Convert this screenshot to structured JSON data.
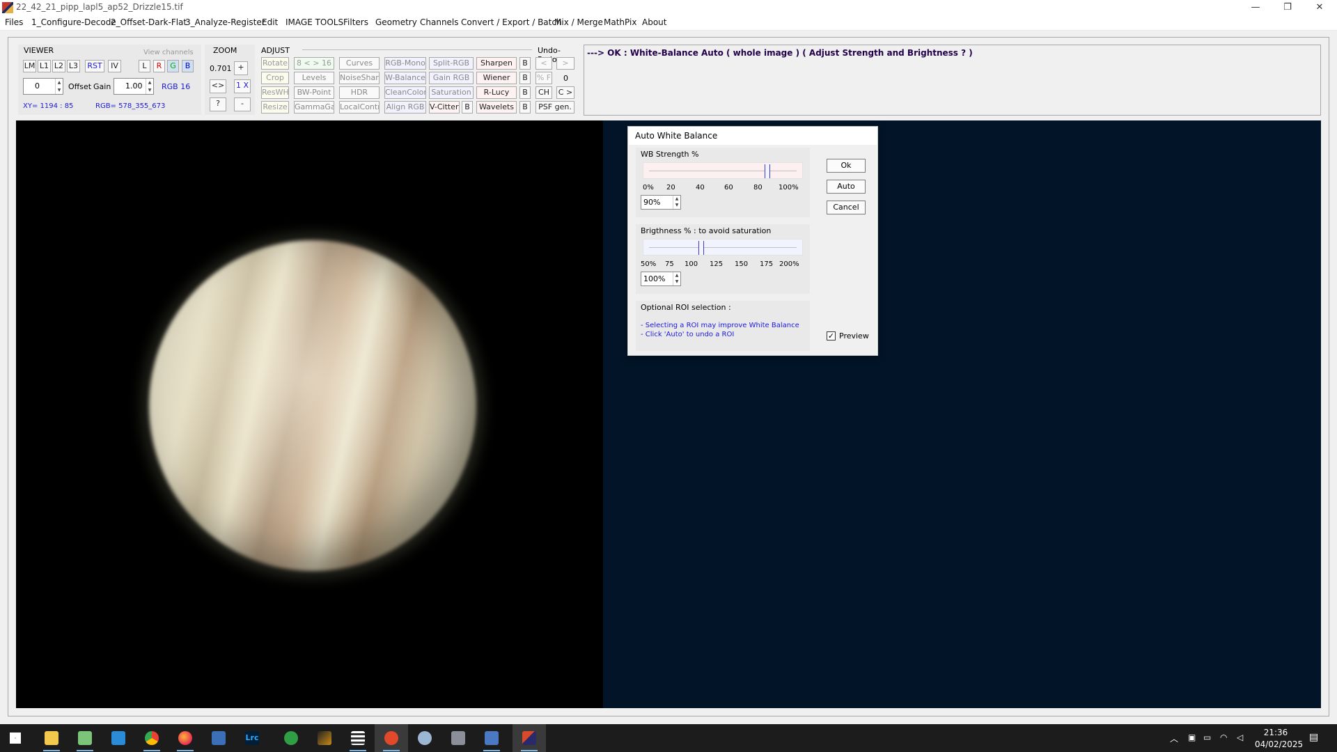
{
  "window": {
    "title": "22_42_21_pipp_lapl5_ap52_Drizzle15.tif",
    "controls": [
      "—",
      "❐",
      "✕"
    ]
  },
  "menu": [
    "Files",
    "1_Configure-Decode",
    "2_Offset-Dark-Flat",
    "3_Analyze-Register",
    "Edit",
    "IMAGE TOOLS",
    "Filters",
    "Geometry",
    "Channels",
    "Convert / Export / Batch",
    "Mix / Merge",
    "MathPix",
    "About"
  ],
  "viewer": {
    "label": "VIEWER",
    "view_channels_label": "View channels",
    "buttons": [
      "LM",
      "L1",
      "L2",
      "L3",
      "RST",
      "IV"
    ],
    "channel_buttons": [
      "L",
      "R",
      "G",
      "B"
    ],
    "offset_value": "0",
    "offset_label": "Offset",
    "gain_label": "Gain",
    "gain_value": "1.00",
    "rgb_depth": "RGB 16",
    "xy": "XY=  1194 : 85",
    "rgb": "RGB=  578_355_673"
  },
  "zoom": {
    "label": "ZOOM",
    "value": "0.701",
    "plus": "+",
    "fit": "<>",
    "one": "1 X",
    "help": "?",
    "minus": "-"
  },
  "adjust": {
    "label": "ADJUST",
    "undo_label": "Undo-Redo",
    "row1": [
      "Rotate",
      "8 < > 16",
      "Curves",
      "RGB-Mono",
      "Split-RGB",
      "Sharpen",
      "B",
      "<",
      ">"
    ],
    "row2": [
      "Crop",
      "Levels",
      "NoiseSharp",
      "W-Balance",
      "Gain RGB",
      "Wiener",
      "B",
      "% F",
      "0"
    ],
    "row3": [
      "ResWH",
      "BW-Point",
      "HDR",
      "CleanColor",
      "Saturation",
      "R-Lucy",
      "B",
      "CH",
      "C >"
    ],
    "row4": [
      "Resize",
      "GammaGain",
      "LocalContr",
      "Align RGB",
      "V-Cittert",
      "B",
      "Wavelets",
      "B",
      "PSF gen."
    ]
  },
  "status": {
    "message": "---> OK :  White-Balance Auto   ( whole image )    ( Adjust Strength and Brightness  ? )"
  },
  "dialog": {
    "title": "Auto White Balance",
    "wb_label": "WB Strength %",
    "wb_value": 0.9,
    "wb_ticks": [
      "0%",
      "20",
      "40",
      "60",
      "80",
      "100%"
    ],
    "wb_field": "90%",
    "bright_label": "Brigthness %  :  to avoid saturation",
    "bright_value": 1.0,
    "bright_ticks": [
      "50%",
      "75",
      "100",
      "125",
      "150",
      "175",
      "200%"
    ],
    "bright_field": "100%",
    "roi_label": "Optional ROI selection :",
    "roi_line1": "- Selecting a ROI may improve White Balance",
    "roi_line2": "- Click 'Auto' to undo a ROI",
    "ok": "Ok",
    "auto": "Auto",
    "cancel": "Cancel",
    "preview_label": "Preview",
    "preview_checked": true
  },
  "taskbar": {
    "time": "21:36",
    "date": "04/02/2025",
    "apps": [
      "windows-start",
      "file-explorer",
      "notepad",
      "vscode",
      "chrome",
      "firefox",
      "astro-tool",
      "lightroom-classic",
      "xbox",
      "autostakkert",
      "sharpcap",
      "asi-studio",
      "paint",
      "registax",
      "image-viewer",
      "winjupos"
    ]
  },
  "colors": {
    "status_text": "#23004a",
    "roi_text": "#1a1ae0",
    "image_background": "#021428",
    "taskbar": "#1c1c1c"
  }
}
